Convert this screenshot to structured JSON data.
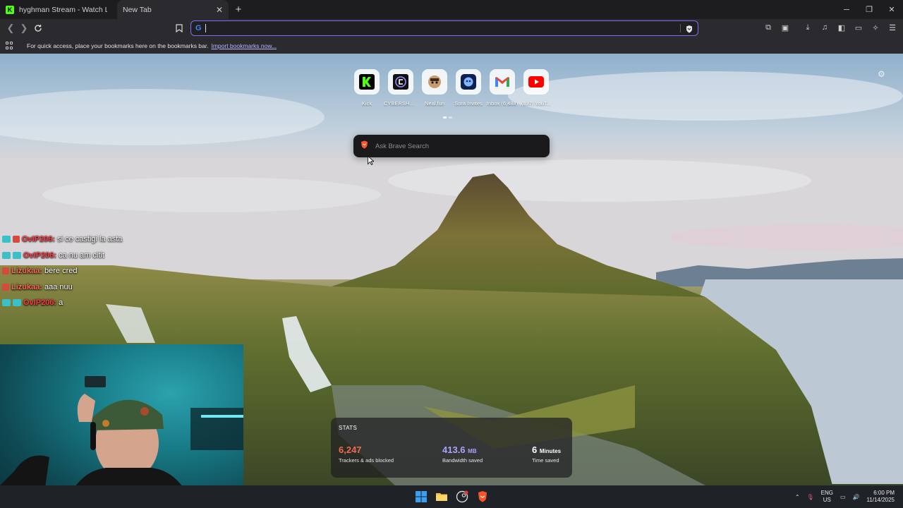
{
  "tabs": [
    {
      "title": "hyghman Stream - Watch Live on Kick",
      "favicon": "kick-logo"
    },
    {
      "title": "New Tab"
    }
  ],
  "toolbar": {
    "address_value": "",
    "search_engine_icon": "google-g-icon"
  },
  "bookmarks_bar": {
    "message": "For quick access, place your bookmarks here on the bookmarks bar.",
    "import_link": "Import bookmarks now..."
  },
  "top_sites": [
    {
      "label": "Kick",
      "icon": "kick-icon"
    },
    {
      "label": "CYBERSHO...",
      "icon": "cybershoke-icon"
    },
    {
      "label": "Neal.fun",
      "icon": "neal-fun-icon"
    },
    {
      "label": "Sora Invites",
      "icon": "sora-icon"
    },
    {
      "label": "Inbox (6,488)",
      "icon": "gmail-icon"
    },
    {
      "label": "(837) YouT...",
      "icon": "youtube-icon"
    }
  ],
  "search": {
    "placeholder": "Ask Brave Search"
  },
  "chat": [
    {
      "user": "OvIP206:",
      "message": "si ce castigi la asta"
    },
    {
      "user": "OvIP206:",
      "message": "ca nu am citit"
    },
    {
      "user": "Lizukaa:",
      "message": "bere cred"
    },
    {
      "user": "Lizukaa:",
      "message": "aaa nuu"
    },
    {
      "user": "OvIP206:",
      "message": "a"
    }
  ],
  "stats": {
    "heading": "STATS",
    "trackers": {
      "value": "6,247",
      "caption": "Trackers & ads blocked",
      "color": "#f06a53"
    },
    "bandwidth": {
      "value": "413.6",
      "unit": "MB",
      "caption": "Bandwidth saved",
      "color": "#a9a3ff"
    },
    "time": {
      "value": "6",
      "unit": "Minutes",
      "caption": "Time saved",
      "color": "#ffffff"
    }
  },
  "taskbar": {
    "lang_line1": "ENG",
    "lang_line2": "US",
    "time": "6:00 PM",
    "date": "11/14/2025"
  }
}
